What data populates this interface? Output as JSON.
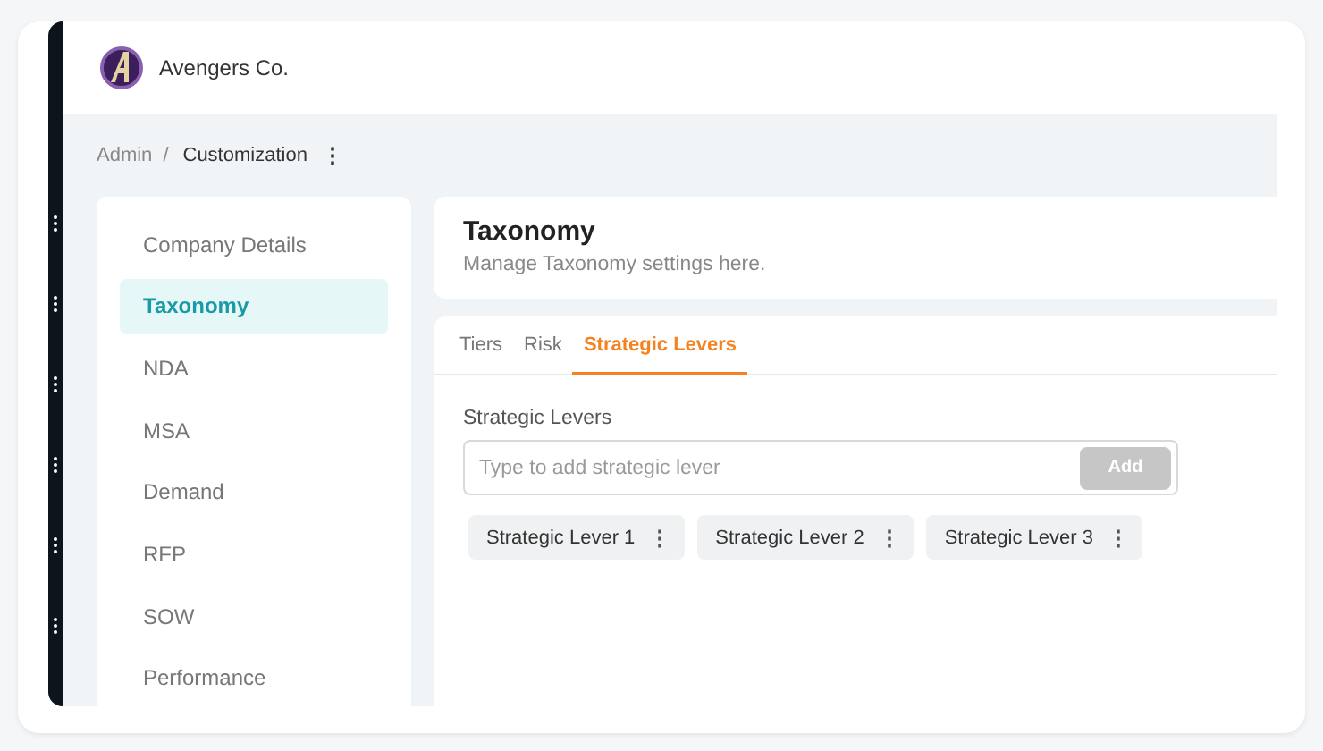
{
  "header": {
    "company": "Avengers Co."
  },
  "breadcrumb": {
    "items": [
      "Admin",
      "/",
      "Customization"
    ],
    "menu_icon": "⋮"
  },
  "sidebar": {
    "items": [
      {
        "label": "Company Details",
        "selected": false
      },
      {
        "label": "Taxonomy",
        "selected": true
      },
      {
        "label": "NDA",
        "selected": false
      },
      {
        "label": "MSA",
        "selected": false
      },
      {
        "label": "Demand",
        "selected": false
      },
      {
        "label": "RFP",
        "selected": false
      },
      {
        "label": "SOW",
        "selected": false
      },
      {
        "label": "Performance",
        "selected": false
      }
    ]
  },
  "page": {
    "title": "Taxonomy",
    "subtitle": "Manage Taxonomy settings here."
  },
  "tabs": [
    {
      "label": "Tiers",
      "selected": false
    },
    {
      "label": "Risk",
      "selected": false
    },
    {
      "label": "Strategic Levers",
      "selected": true
    }
  ],
  "form": {
    "label": "Strategic Levers",
    "placeholder": "Type to add strategic lever",
    "add_button": "Add",
    "add_disabled": true
  },
  "chips": [
    {
      "label": "Strategic Lever 1",
      "menu": "⋮"
    },
    {
      "label": "Strategic Lever 2",
      "menu": "⋮"
    },
    {
      "label": "Strategic Lever 3",
      "menu": "⋮"
    }
  ]
}
